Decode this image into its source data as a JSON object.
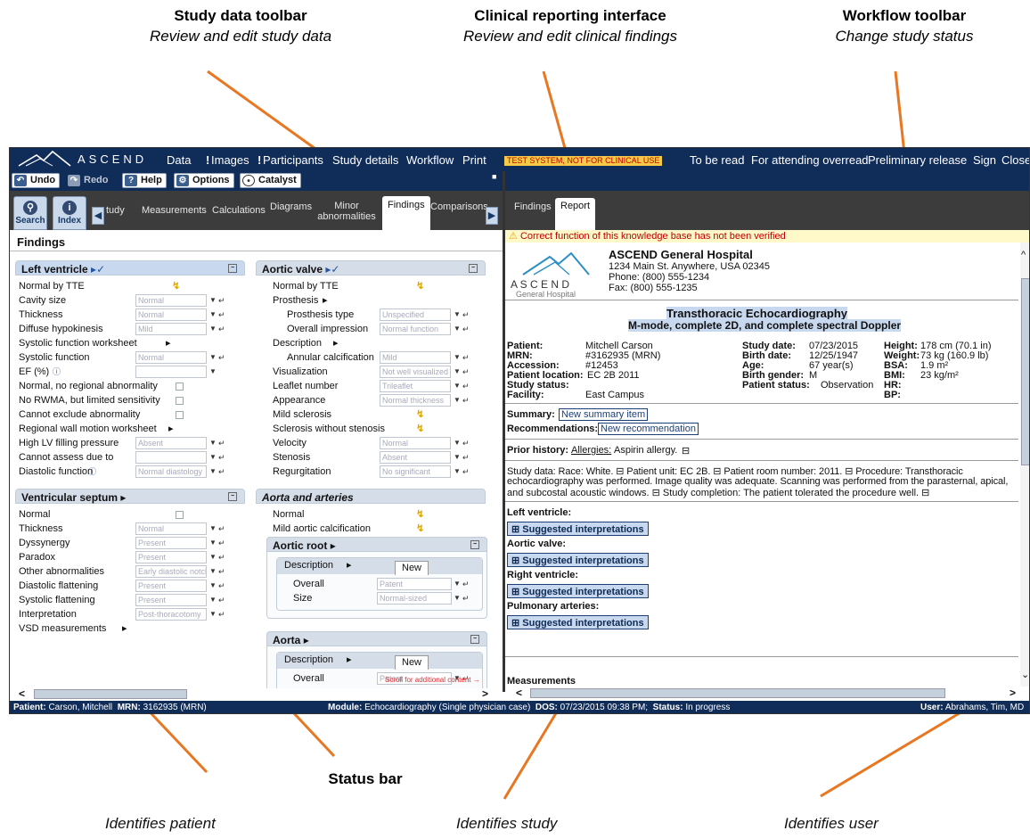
{
  "callouts": {
    "toolbar_title": "Study data toolbar",
    "toolbar_sub": "Review and edit study data",
    "clinical_title": "Clinical reporting interface",
    "clinical_sub": "Review and edit clinical findings",
    "workflow_title": "Workflow toolbar",
    "workflow_sub": "Change study status",
    "status_bar": "Status bar",
    "ident_patient": "Identifies patient",
    "ident_study": "Identifies study",
    "ident_user": "Identifies user"
  },
  "topbar": {
    "logo": "ASCEND",
    "menu": [
      "Data",
      "Images",
      "Participants",
      "Study details",
      "Workflow",
      "Print"
    ],
    "test_banner": "TEST SYSTEM, NOT FOR CLINICAL USE",
    "workflow": [
      "To be read",
      "For attending overread",
      "Preliminary release",
      "Sign",
      "Close"
    ]
  },
  "toolbar": {
    "undo": "Undo",
    "redo": "Redo",
    "help": "Help",
    "options": "Options",
    "catalyst": "Catalyst"
  },
  "left_tabs": {
    "search": "Search",
    "index": "Index",
    "tabs": [
      "tudy",
      "Measurements",
      "Calculations",
      "Diagrams",
      "Minor abnormalities",
      "Findings",
      "Comparisons"
    ]
  },
  "right_tabs": [
    "Findings",
    "Report"
  ],
  "warning": "Correct function of this knowledge base has not been verified",
  "findings": {
    "title": "Findings",
    "lv": {
      "header": "Left ventricle",
      "rows": [
        {
          "label": "Normal by TTE"
        },
        {
          "label": "Cavity size",
          "value": "Normal"
        },
        {
          "label": "Thickness",
          "value": "Normal"
        },
        {
          "label": "Diffuse hypokinesis",
          "value": "Mild"
        },
        {
          "label": "Systolic function worksheet"
        },
        {
          "label": "Systolic function",
          "value": "Normal"
        },
        {
          "label": "EF (%)",
          "value": ""
        },
        {
          "label": "Normal, no regional abnormality"
        },
        {
          "label": "No RWMA, but limited sensitivity"
        },
        {
          "label": "Cannot exclude abnormality"
        },
        {
          "label": "Regional wall motion worksheet"
        },
        {
          "label": "High LV filling pressure",
          "value": "Absent"
        },
        {
          "label": "Cannot assess due to",
          "value": ""
        },
        {
          "label": "Diastolic function",
          "value": "Normal diastology"
        }
      ]
    },
    "vs": {
      "header": "Ventricular septum",
      "rows": [
        {
          "label": "Normal"
        },
        {
          "label": "Thickness",
          "value": "Normal"
        },
        {
          "label": "Dyssynergy",
          "value": "Present"
        },
        {
          "label": "Paradox",
          "value": "Present"
        },
        {
          "label": "Other abnormalities",
          "value": "Early diastolic notch"
        },
        {
          "label": "Diastolic flattening",
          "value": "Present"
        },
        {
          "label": "Systolic flattening",
          "value": "Present"
        },
        {
          "label": "Interpretation",
          "value": "Post-thoracotomy"
        },
        {
          "label": "VSD measurements"
        }
      ]
    },
    "av": {
      "header": "Aortic valve",
      "rows": [
        {
          "label": "Normal by TTE"
        },
        {
          "label": "Prosthesis"
        },
        {
          "label": "Prosthesis type",
          "value": "Unspecified"
        },
        {
          "label": "Overall impression",
          "value": "Normal function"
        },
        {
          "label": "Description"
        },
        {
          "label": "Annular calcification",
          "value": "Mild"
        },
        {
          "label": "Visualization",
          "value": "Not well visualized"
        },
        {
          "label": "Leaflet number",
          "value": "Trileaflet"
        },
        {
          "label": "Appearance",
          "value": "Normal thickness"
        },
        {
          "label": "Mild sclerosis"
        },
        {
          "label": "Sclerosis without stenosis"
        },
        {
          "label": "Velocity",
          "value": "Normal"
        },
        {
          "label": "Stenosis",
          "value": "Absent"
        },
        {
          "label": "Regurgitation",
          "value": "No significant"
        }
      ]
    },
    "aa": {
      "header": "Aorta and arteries",
      "normal": "Normal",
      "mild": "Mild aortic calcification",
      "root": {
        "header": "Aortic root",
        "desc": "Description",
        "new": "New",
        "overall": "Overall",
        "overall_v": "Patent",
        "size": "Size",
        "size_v": "Normal-sized"
      },
      "aorta": {
        "header": "Aorta",
        "desc": "Description",
        "new": "New",
        "overall": "Overall",
        "overall_v": "Patent"
      }
    },
    "scroll_hint": "Scroll for additional content →"
  },
  "report": {
    "hospital": "ASCEND General Hospital",
    "address": "1234 Main St. Anywhere, USA 02345",
    "phone": "Phone: (800) 555-1234",
    "fax": "Fax: (800) 555-1235",
    "logo_word": "A S C E N D",
    "logo_sub": "General Hospital",
    "title": "Transthoracic Echocardiography",
    "subtitle": "M-mode, complete 2D, and complete spectral Doppler",
    "col1_labels": [
      "Patient:",
      "MRN:",
      "Accession:",
      "Patient location:",
      "Study status:",
      "Facility:"
    ],
    "col1_values": [
      "Mitchell Carson",
      "#3162935 (MRN)",
      "#12453",
      "EC 2B 2011",
      "",
      "East Campus"
    ],
    "col2_labels": [
      "Study date:",
      "Birth date:",
      "Age:",
      "Birth gender:",
      "Patient status:"
    ],
    "col2_values": [
      "07/23/2015",
      "12/25/1947",
      "67 year(s)",
      "M",
      "Observation"
    ],
    "col3_labels": [
      "Height:",
      "Weight:",
      "BSA:",
      "BMI:",
      "HR:",
      "BP:"
    ],
    "col3_values": [
      "178 cm (70.1 in)",
      "73 kg (160.9 lb)",
      "1.9 m²",
      "23 kg/m²",
      "",
      ""
    ],
    "summary_label": "Summary:",
    "summary_btn": "New summary item",
    "rec_label": "Recommendations:",
    "rec_btn": "New recommendation",
    "prior_label": "Prior history:",
    "prior_link": "Allergies:",
    "prior_text": "Aspirin allergy.",
    "studydata_1": "Study data: Race: White. ⊟ Patient unit: EC 2B. ⊟ Patient room number: 2011. ⊟ Procedure: Transthoracic",
    "studydata_2": "echocardiography was performed. Image quality was adequate. Scanning was performed from the parasternal, apical,",
    "studydata_3": "and subcostal acoustic windows. ⊟ Study completion: The patient tolerated the procedure well. ⊟",
    "sections": [
      "Left ventricle:",
      "Aortic valve:",
      "Right ventricle:",
      "Pulmonary arteries:"
    ],
    "sugg": "Suggested interpretations",
    "measurements": "Measurements"
  },
  "status": {
    "patient_label": "Patient:",
    "patient": "Carson, Mitchell",
    "mrn_label": "MRN:",
    "mrn": "3162935 (MRN)",
    "module_label": "Module:",
    "module": "Echocardiography (Single physician case)",
    "dos_label": "DOS:",
    "dos": "07/23/2015 09:38 PM;",
    "status_label": "Status:",
    "status": "In progress",
    "user_label": "User:",
    "user": "Abrahams, Tim, MD"
  }
}
